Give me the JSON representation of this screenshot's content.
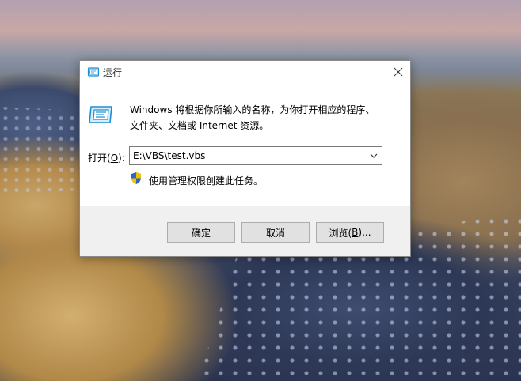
{
  "dialog": {
    "title": "运行",
    "description_line1": "Windows 将根据你所输入的名称，为你打开相应的程序、",
    "description_line2": "文件夹、文档或 Internet 资源。",
    "open_label_prefix": "打开(",
    "open_label_key": "O",
    "open_label_suffix": "):",
    "open_value": "E:\\VBS\\test.vbs",
    "admin_note": "使用管理权限创建此任务。",
    "ok_label": "确定",
    "cancel_label": "取消",
    "browse_label_prefix": "浏览(",
    "browse_label_key": "B",
    "browse_label_suffix": ")..."
  },
  "icons": {
    "title": "run-icon",
    "big": "run-large-icon",
    "close": "close-icon",
    "dropdown": "chevron-down-icon",
    "admin": "uac-shield-icon"
  },
  "colors": {
    "dialog_bg": "#ffffff",
    "footer_bg": "#f0f0f0",
    "button_bg": "#e1e1e1",
    "accent": "#1e90d4"
  }
}
